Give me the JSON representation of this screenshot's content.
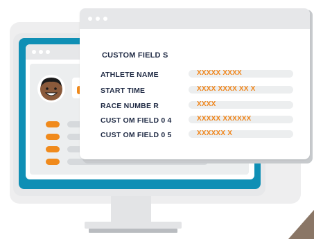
{
  "panel": {
    "header": "CUSTOM FIELD S",
    "fields": [
      {
        "label": "ATHLETE NAME",
        "value": "XXXXX XXXX"
      },
      {
        "label": "START TIME",
        "value": "XXXX XXXX XX X"
      },
      {
        "label": "RACE NUMBE R",
        "value": "XXXX"
      },
      {
        "label": "CUST OM FIELD 0 4",
        "value": "XXXXX XXXXXX"
      },
      {
        "label": "CUST OM FIELD 0 5",
        "value": "XXXXXX X"
      }
    ]
  },
  "colors": {
    "accent_orange": "#f08a1c",
    "label_navy": "#1f2a44",
    "screen_blue": "#0f8fb5",
    "window_gray": "#e6e7e9"
  },
  "icons": [
    "user-avatar-icon"
  ]
}
